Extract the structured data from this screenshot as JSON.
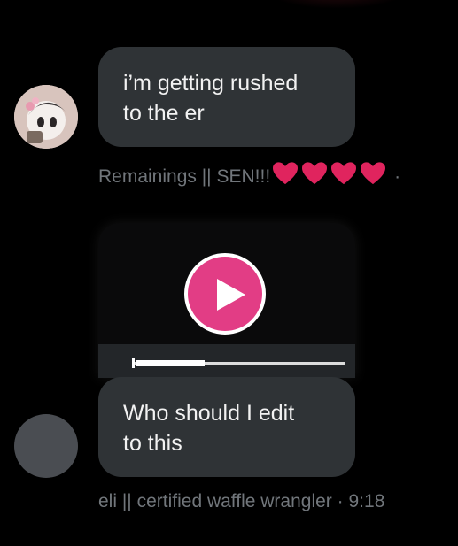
{
  "messages": [
    {
      "text_lines": [
        "i’m getting rushed",
        "to the er"
      ],
      "sender": "Remainings || SEN!!!",
      "hearts": 4,
      "separator": "·",
      "time": ""
    },
    {
      "text_lines": [
        "Who should I edit",
        "to this"
      ],
      "sender": "eli || certified waffle wrangler",
      "separator": "·",
      "time": "9:18"
    }
  ],
  "video": {
    "progress": 0.33
  },
  "colors": {
    "background": "#000000",
    "bubble": "#2f3336",
    "meta_text": "#71767b",
    "play_button": "#e23d85",
    "heart": "#e0245e"
  },
  "icons": {
    "heart": "heart-icon",
    "play": "play-icon"
  }
}
